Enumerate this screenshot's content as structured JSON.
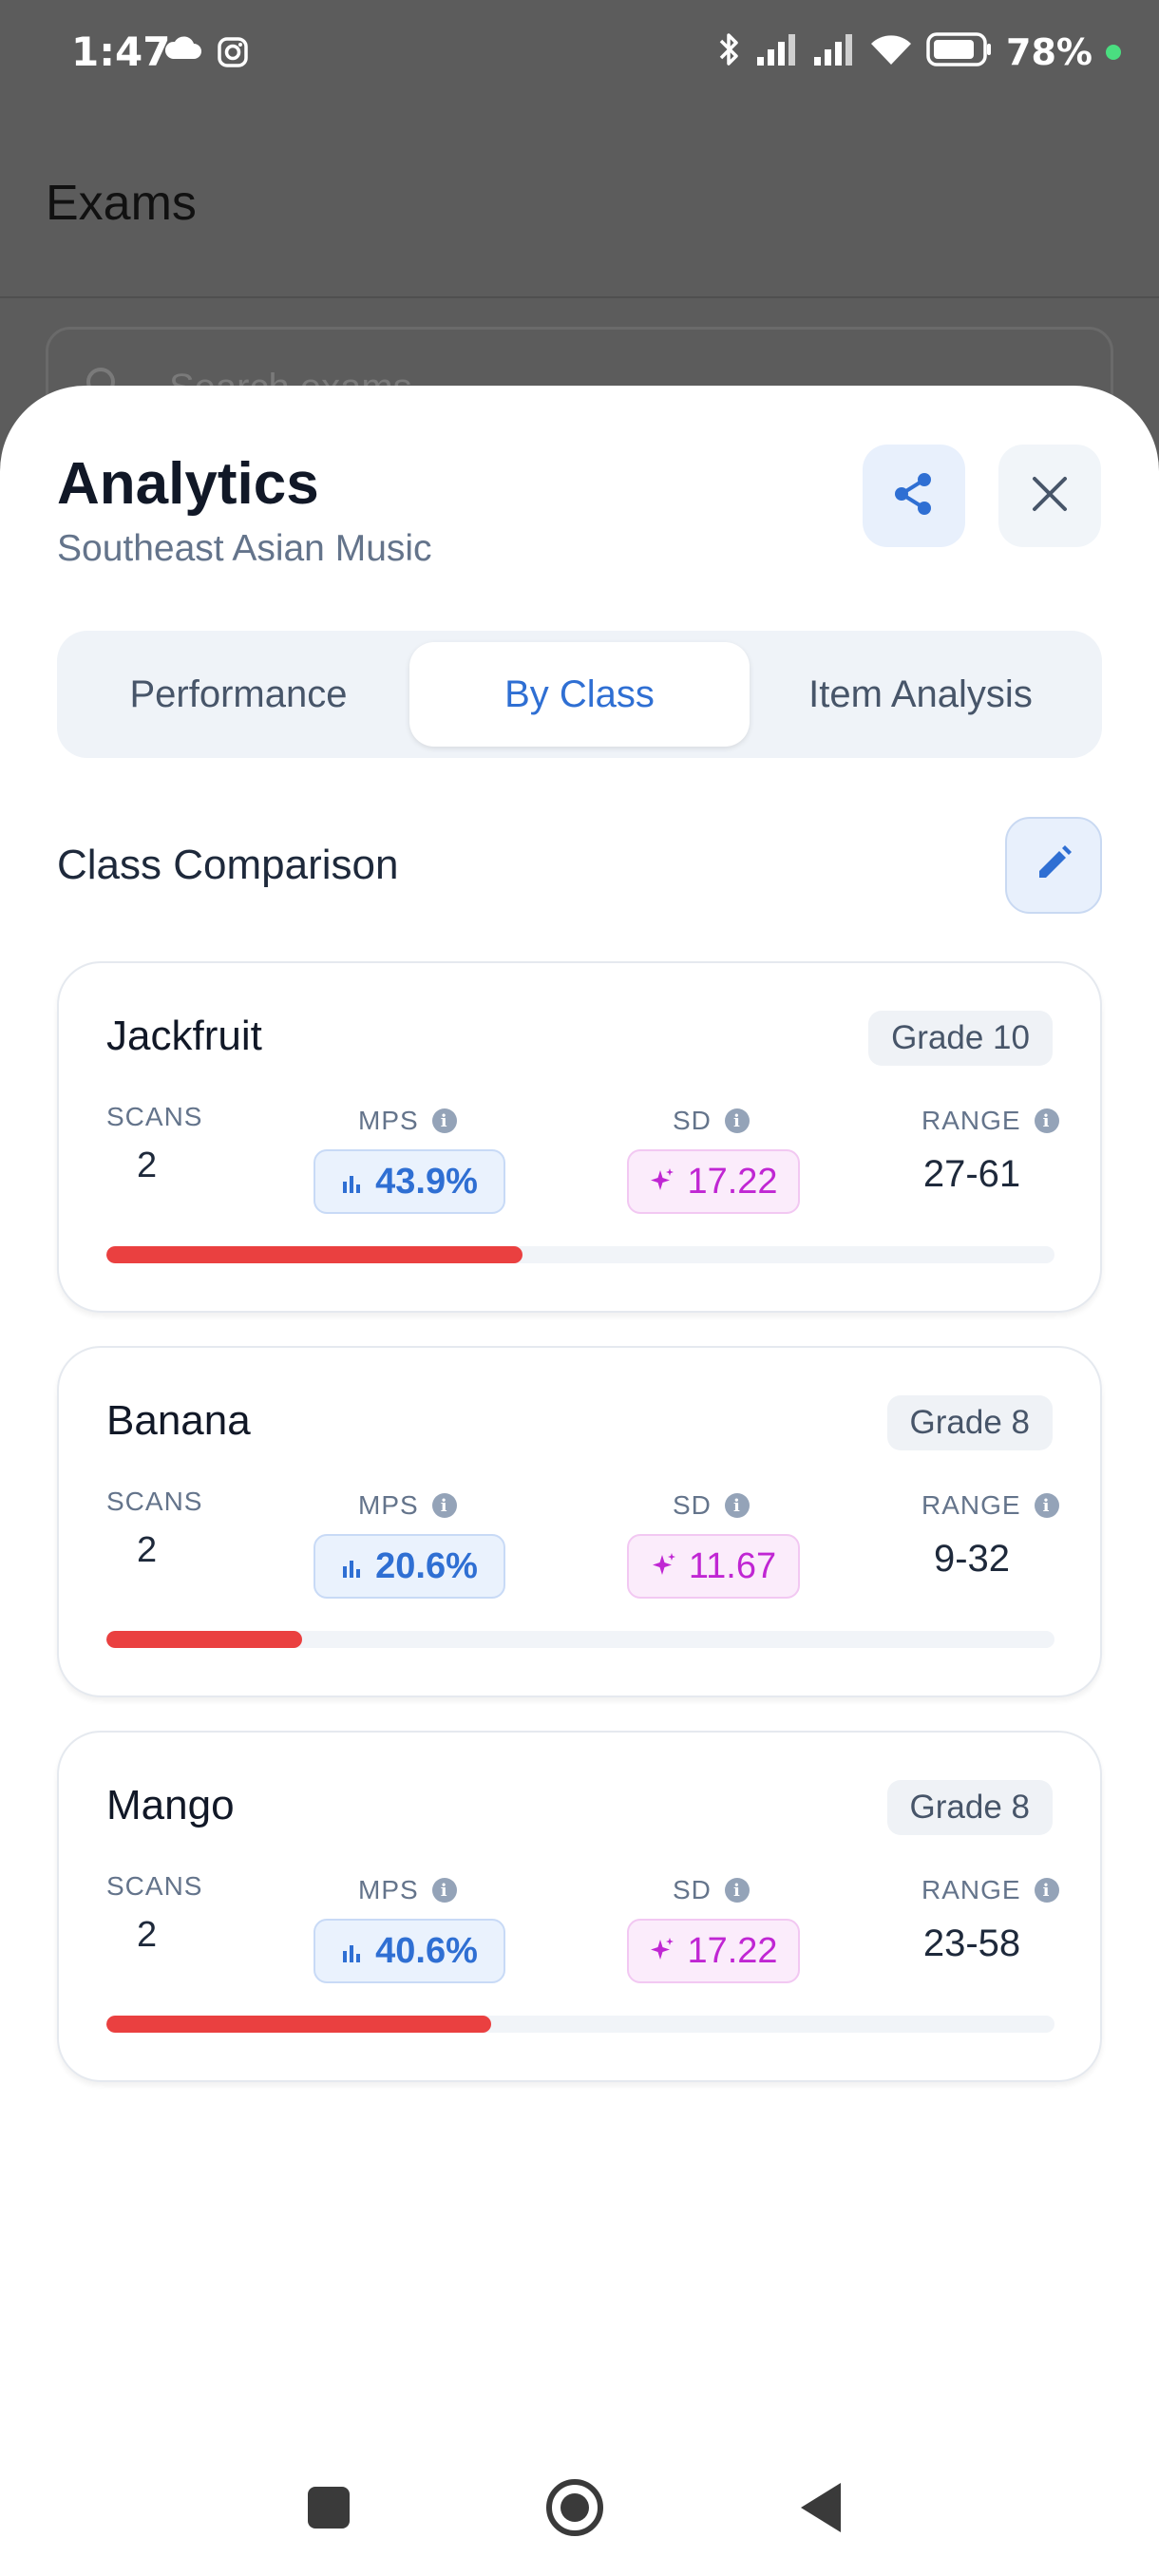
{
  "status_bar": {
    "time": "1:47",
    "battery": "78%"
  },
  "background": {
    "app_title": "Exams",
    "search_placeholder": "Search exams"
  },
  "sheet": {
    "title": "Analytics",
    "subtitle": "Southeast Asian Music",
    "tabs": [
      {
        "label": "Performance",
        "active": false
      },
      {
        "label": "By Class",
        "active": true
      },
      {
        "label": "Item Analysis",
        "active": false
      }
    ],
    "section_title": "Class Comparison",
    "labels": {
      "scans": "SCANS",
      "mps": "MPS",
      "sd": "SD",
      "range": "RANGE"
    },
    "classes": [
      {
        "name": "Jackfruit",
        "grade": "Grade 10",
        "scans": "2",
        "mps": "43.9%",
        "sd": "17.22",
        "range": "27-61",
        "progress": 0.439
      },
      {
        "name": "Banana",
        "grade": "Grade 8",
        "scans": "2",
        "mps": "20.6%",
        "sd": "11.67",
        "range": "9-32",
        "progress": 0.206
      },
      {
        "name": "Mango",
        "grade": "Grade 8",
        "scans": "2",
        "mps": "40.6%",
        "sd": "17.22",
        "range": "23-58",
        "progress": 0.406
      }
    ]
  },
  "colors": {
    "accent": "#2f6fd3",
    "progress_fill": "#ea4040",
    "sd_color": "#c026d3"
  }
}
